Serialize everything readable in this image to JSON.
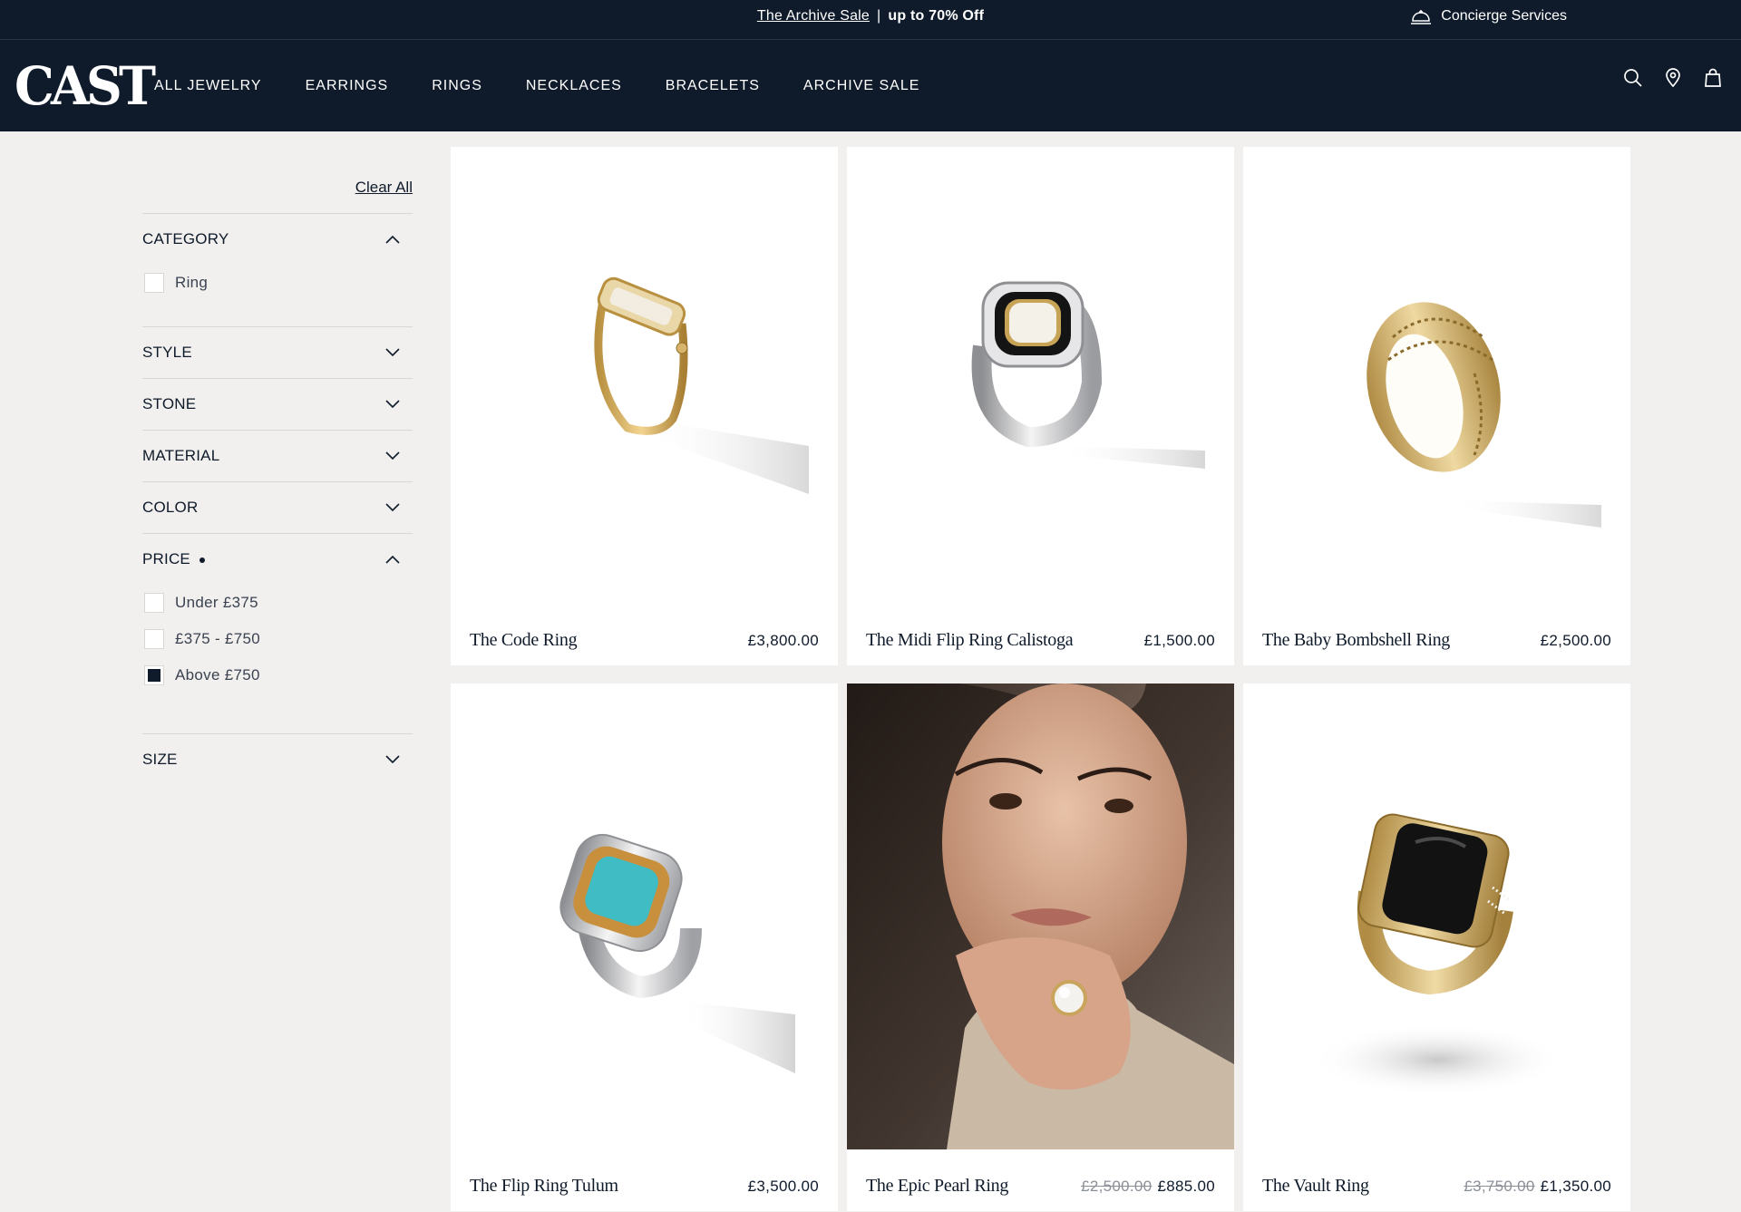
{
  "announcement": {
    "sale_link": "The Archive Sale",
    "separator": "|",
    "offer": "up to 70% Off",
    "concierge": "Concierge Services"
  },
  "nav": {
    "logo": "CAST",
    "links": [
      "ALL JEWELRY",
      "EARRINGS",
      "RINGS",
      "NECKLACES",
      "BRACELETS",
      "ARCHIVE SALE"
    ],
    "icons": [
      "search-icon",
      "location-pin-icon",
      "shopping-bag-icon"
    ]
  },
  "filters": {
    "clear_all": "Clear All",
    "groups": [
      {
        "label": "CATEGORY",
        "expanded": true,
        "options": [
          {
            "label": "Ring",
            "checked": false
          }
        ]
      },
      {
        "label": "STYLE",
        "expanded": false
      },
      {
        "label": "STONE",
        "expanded": false
      },
      {
        "label": "MATERIAL",
        "expanded": false
      },
      {
        "label": "COLOR",
        "expanded": false
      },
      {
        "label": "PRICE",
        "expanded": true,
        "active": true,
        "options": [
          {
            "label": "Under £375",
            "checked": false
          },
          {
            "label": "£375 - £750",
            "checked": false
          },
          {
            "label": "Above £750",
            "checked": true
          }
        ]
      },
      {
        "label": "SIZE",
        "expanded": false
      }
    ]
  },
  "products": [
    {
      "name": "The Code Ring",
      "price": "£3,800.00",
      "old_price": ""
    },
    {
      "name": "The Midi Flip Ring Calistoga",
      "price": "£1,500.00",
      "old_price": ""
    },
    {
      "name": "The Baby Bombshell Ring",
      "price": "£2,500.00",
      "old_price": ""
    },
    {
      "name": "The Flip Ring Tulum",
      "price": "£3,500.00",
      "old_price": ""
    },
    {
      "name": "The Epic Pearl Ring",
      "price": "£885.00",
      "old_price": "£2,500.00"
    },
    {
      "name": "The Vault Ring",
      "price": "£1,350.00",
      "old_price": "£3,750.00"
    }
  ],
  "colors": {
    "navy": "#0f1b2b",
    "background": "#f1f0ef",
    "gold": "#d2b26b",
    "silver": "#d9d9dc",
    "turquoise": "#3fbcc4",
    "onyx": "#121212"
  }
}
